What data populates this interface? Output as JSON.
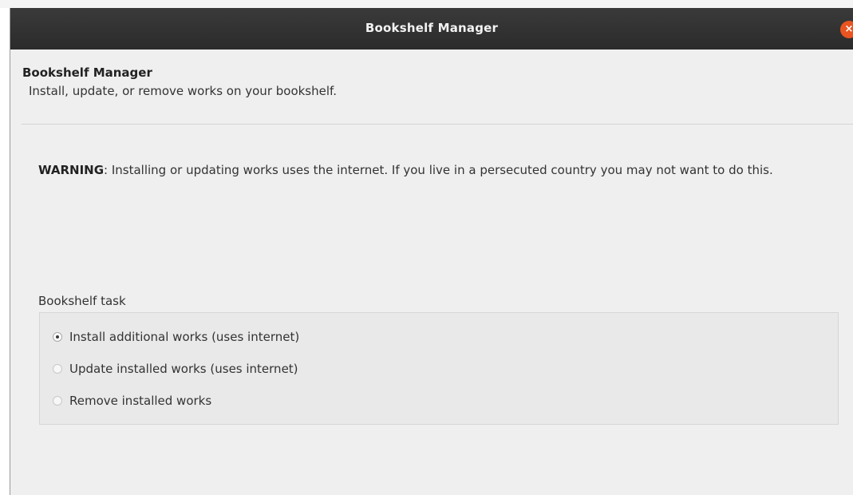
{
  "window": {
    "title": "Bookshelf Manager",
    "close_icon": "×"
  },
  "header": {
    "title": "Bookshelf Manager",
    "subtitle": "Install, update, or remove works on your bookshelf."
  },
  "warning": {
    "label": "WARNING",
    "text": ": Installing or updating works uses the internet. If you live in a persecuted country you may not want to do this."
  },
  "task": {
    "label": "Bookshelf task",
    "options": [
      {
        "label": "Install additional works (uses internet)",
        "selected": true
      },
      {
        "label": "Update installed works (uses internet)",
        "selected": false
      },
      {
        "label": "Remove installed works",
        "selected": false
      }
    ]
  },
  "colors": {
    "titlebar": "#2d2d2d",
    "close_button": "#e95420",
    "background": "#efefef"
  }
}
